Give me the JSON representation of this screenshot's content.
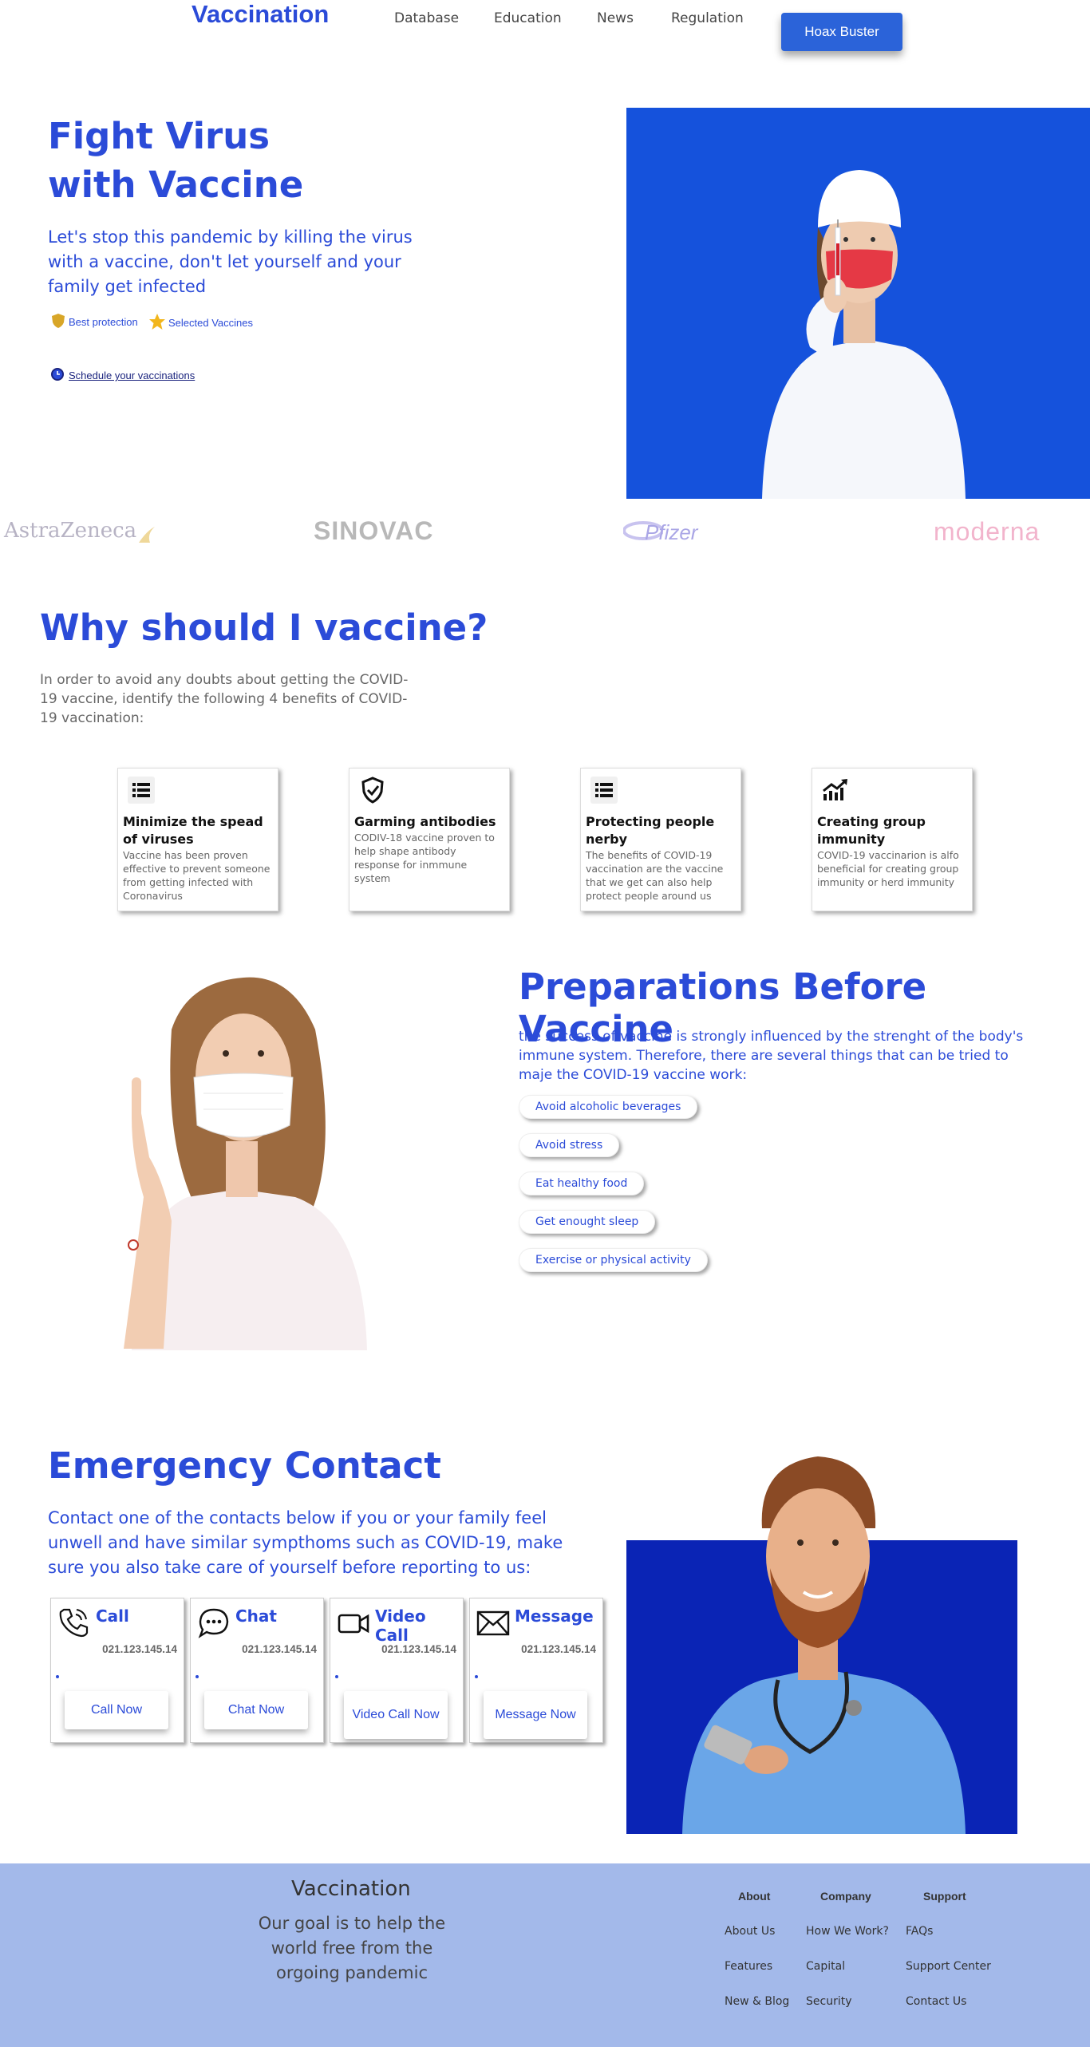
{
  "nav": {
    "logo": "Vaccination",
    "links": [
      "Database",
      "Education",
      "News",
      "Regulation"
    ],
    "cta": "Hoax Buster"
  },
  "hero": {
    "title_line1": "Fight Virus",
    "title_line2": "with Vaccine",
    "subtitle": "Let's stop this pandemic by killing the virus with a vaccine, don't let yourself and your family get infected",
    "badges": [
      "Best protection",
      "Selected Vaccines"
    ],
    "schedule_link": "Schedule your vaccinations"
  },
  "brands": [
    "AstraZeneca",
    "SINOVAC",
    "Pfizer",
    "moderna"
  ],
  "why": {
    "title": "Why should I vaccine?",
    "subtitle": "In order to avoid any doubts about getting the COVID-19 vaccine, identify the following 4 benefits of COVID-19 vaccination:",
    "cards": [
      {
        "title": "Minimize the spead of viruses",
        "text": "Vaccine has been proven effective to prevent someone from getting infected with Coronavirus",
        "icon": "list-icon"
      },
      {
        "title": "Garming antibodies",
        "text": "CODIV-18 vaccine proven to help shape antibody response for inmmune system",
        "icon": "shield-check-icon"
      },
      {
        "title": "Protecting people nerby",
        "text": "The benefits of COVID-19 vaccination are the vaccine that we get can also help protect people around us",
        "icon": "list-icon"
      },
      {
        "title": "Creating group immunity",
        "text": "COVID-19 vaccinarion is alfo beneficial for creating group immunity or herd immunity",
        "icon": "trend-up-icon"
      }
    ]
  },
  "prep": {
    "title": "Preparations Before Vaccine",
    "subtitle": "the success of vaccine is strongly influenced by the strenght of the body's immune system. Therefore, there are several things that can be tried to maje the COVID-19 vaccine work:",
    "items": [
      "Avoid alcoholic beverages",
      "Avoid stress",
      "Eat healthy food",
      "Get enought sleep",
      "Exercise or physical activity"
    ]
  },
  "emergency": {
    "title": "Emergency Contact",
    "subtitle": "Contact one of the contacts below if you or your family feel unwell and have similar sympthoms such as COVID-19, make sure you also take care of yourself before reporting to us:",
    "contacts": [
      {
        "title": "Call",
        "number": "021.123.145.14",
        "button": "Call Now",
        "icon": "phone-icon"
      },
      {
        "title": "Chat",
        "number": "021.123.145.14",
        "button": "Chat Now",
        "icon": "chat-icon"
      },
      {
        "title": "Video Call",
        "number": "021.123.145.14",
        "button": "Video Call Now",
        "icon": "video-icon"
      },
      {
        "title": "Message",
        "number": "021.123.145.14",
        "button": "Message Now",
        "icon": "mail-icon"
      }
    ]
  },
  "footer": {
    "brand": "Vaccination",
    "goal": "Our goal is to help the world free from the orgoing pandemic",
    "columns": [
      {
        "heading": "About",
        "links": [
          "About Us",
          "Features",
          "New & Blog"
        ]
      },
      {
        "heading": "Company",
        "links": [
          "How We Work?",
          "Capital",
          "Security"
        ]
      },
      {
        "heading": "Support",
        "links": [
          "FAQs",
          "Support Center",
          "Contact Us"
        ]
      }
    ]
  },
  "colors": {
    "accent": "#2b4bd8",
    "footer_bg": "#a3b9ea",
    "hero_bg": "#1d4fd9"
  }
}
